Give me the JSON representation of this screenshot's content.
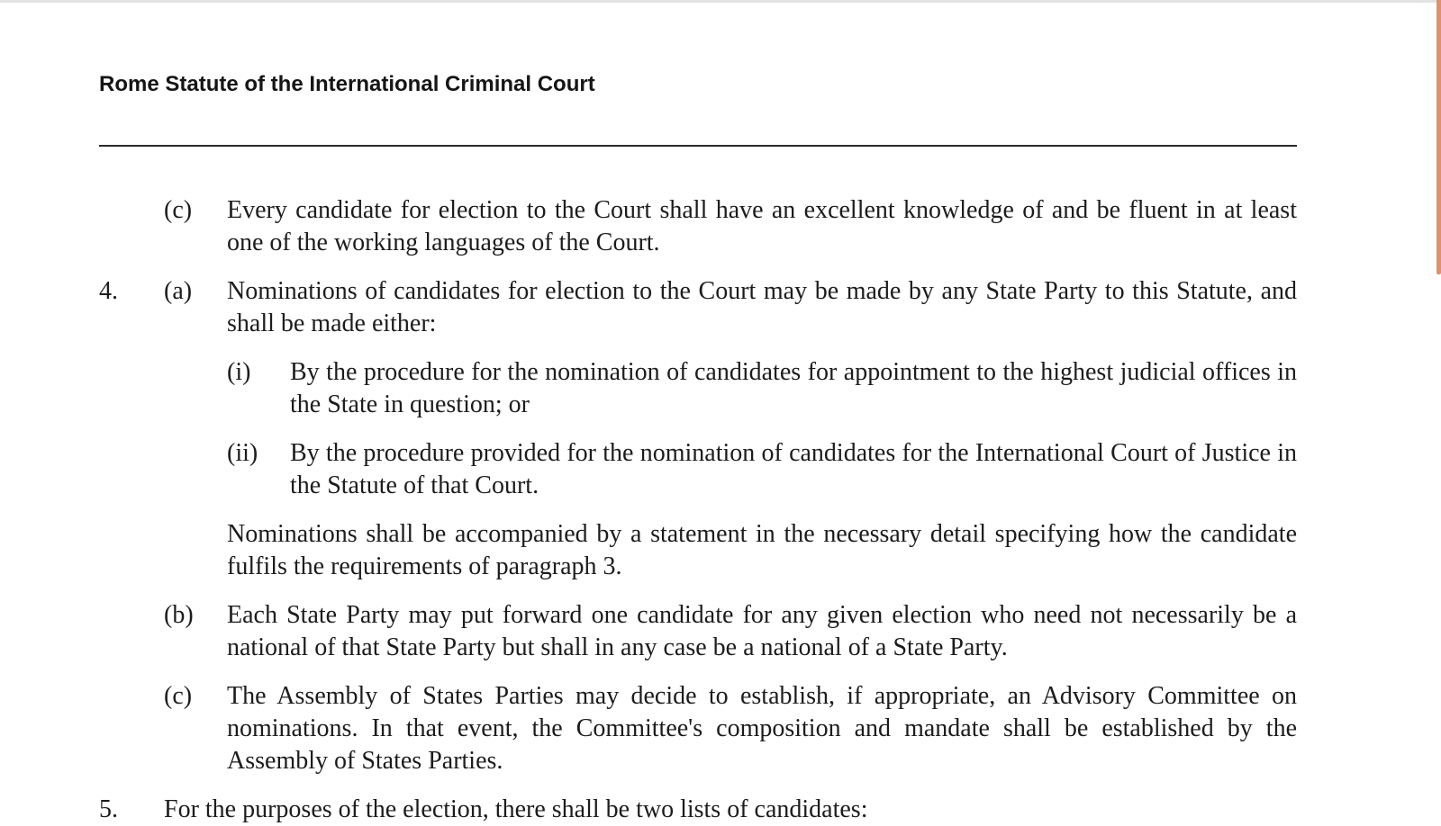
{
  "document": {
    "header_title": "Rome Statute of the International Criminal Court",
    "items": [
      {
        "num": "",
        "sub": "(c)",
        "text": "Every candidate for election to the Court shall have an excellent knowledge of and be fluent in at least one of the working languages of the Court."
      },
      {
        "num": "4.",
        "sub": "(a)",
        "text": "Nominations of candidates for election to the Court may be made by any State Party to this Statute, and shall be made either:"
      },
      {
        "sub2": "(i)",
        "text": "By the procedure for the nomination of candidates for appointment to the highest judicial offices in the State in question; or"
      },
      {
        "sub2": "(ii)",
        "text": "By the procedure provided for the nomination of candidates for the International Court of Justice in the Statute of that Court."
      },
      {
        "text": "Nominations shall be accompanied by a statement in the necessary detail specifying how the candidate fulfils the requirements of paragraph 3."
      },
      {
        "num": "",
        "sub": "(b)",
        "text": "Each State Party may put forward one candidate for any given election who need not necessarily be a national of that State Party but shall in any case be a national of a State Party."
      },
      {
        "num": "",
        "sub": "(c)",
        "text": "The Assembly of States Parties may decide to establish, if appropriate, an Advisory Committee on nominations. In that event, the Committee's composition and mandate shall be established by the Assembly of States Parties."
      },
      {
        "num": "5.",
        "text": "For the purposes of the election, there shall be two lists of candidates:"
      }
    ]
  },
  "colors": {
    "scrollbar_thumb": "#e0906a",
    "text": "#1c1c1c"
  }
}
